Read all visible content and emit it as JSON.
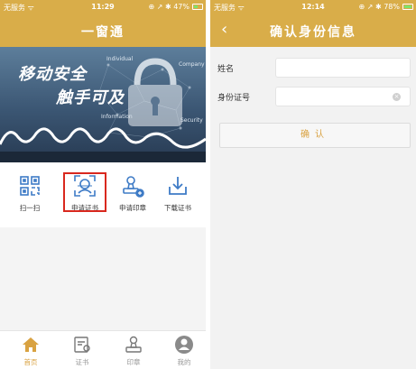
{
  "left": {
    "status": {
      "carrier": "无服务 ᯤ",
      "time": "11:29",
      "icons": "⊕ ↗ ✱ 47%",
      "battery_level": 0.47
    },
    "title": "一窗通",
    "banner": {
      "slogan1": "移动安全",
      "slogan2": "触手可及",
      "tags": [
        "Individual",
        "Company",
        "Information",
        "Security"
      ]
    },
    "functions": [
      {
        "label": "扫一扫",
        "icon": "qr-scan-icon"
      },
      {
        "label": "申请证书",
        "icon": "face-scan-icon"
      },
      {
        "label": "申请印章",
        "icon": "seal-stamp-icon"
      },
      {
        "label": "下载证书",
        "icon": "download-icon"
      }
    ],
    "tabs": [
      {
        "label": "首页",
        "icon": "home-icon",
        "active": true
      },
      {
        "label": "证书",
        "icon": "certificate-icon",
        "active": false
      },
      {
        "label": "印章",
        "icon": "seal-icon",
        "active": false
      },
      {
        "label": "我的",
        "icon": "profile-icon",
        "active": false
      }
    ]
  },
  "right": {
    "status": {
      "carrier": "无服务 ᯤ",
      "time": "12:14",
      "icons": "⊕ ↗ ✱ 78%",
      "battery_level": 0.78
    },
    "back": "‹",
    "title": "确认身份信息",
    "form": {
      "name_label": "姓名",
      "name_value": "",
      "id_label": "身份证号",
      "id_value": "",
      "clear": "×"
    },
    "confirm": "确认"
  },
  "colors": {
    "header": "#d9ad49",
    "accent": "#d9a241",
    "highlight": "#d9281e"
  }
}
